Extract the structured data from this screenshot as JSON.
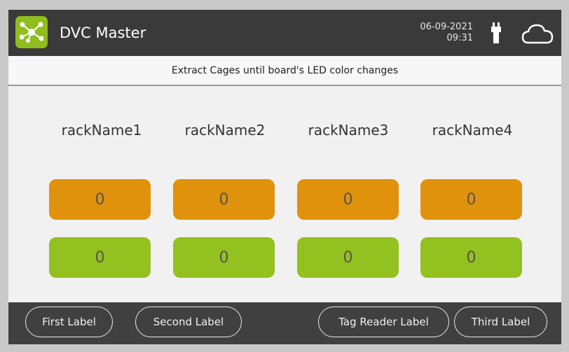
{
  "header": {
    "title": "DVC Master",
    "date": "06-09-2021",
    "time": "09:31",
    "logo_icon": "network-icon",
    "power_icon": "plug-icon",
    "cloud_icon": "cloud-icon"
  },
  "message": "Extract Cages until board's LED color changes",
  "racks": [
    {
      "name": "rackName1",
      "orange_count": "0",
      "green_count": "0"
    },
    {
      "name": "rackName2",
      "orange_count": "0",
      "green_count": "0"
    },
    {
      "name": "rackName3",
      "orange_count": "0",
      "green_count": "0"
    },
    {
      "name": "rackName4",
      "orange_count": "0",
      "green_count": "0"
    }
  ],
  "footer": {
    "first_label": "First Label",
    "second_label": "Second Label",
    "tag_reader_label": "Tag Reader Label",
    "third_label": "Third Label"
  },
  "colors": {
    "accent_green": "#93c11f",
    "accent_orange": "#e0920c",
    "header_bg": "#3a3a3a"
  }
}
